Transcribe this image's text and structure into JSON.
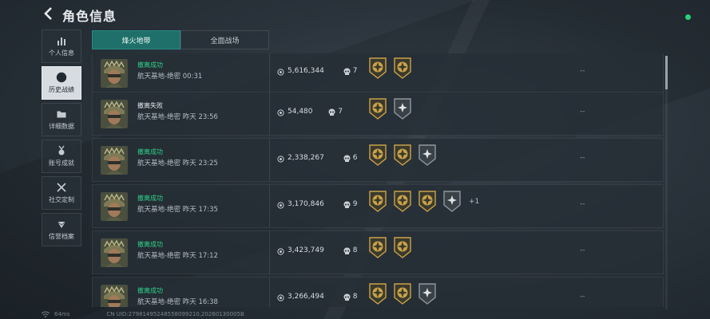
{
  "header": {
    "title": "角色信息"
  },
  "sidebar": {
    "items": [
      {
        "label": "个人信息",
        "icon": "bar-chart-icon"
      },
      {
        "label": "历史战绩",
        "icon": "clock-icon",
        "active": true
      },
      {
        "label": "详细数据",
        "icon": "folder-icon"
      },
      {
        "label": "账号成就",
        "icon": "medal-icon"
      },
      {
        "label": "社交定制",
        "icon": "tools-icon"
      },
      {
        "label": "信誉档案",
        "icon": "gem-icon"
      }
    ]
  },
  "tabs": [
    {
      "label": "烽火地带",
      "active": true
    },
    {
      "label": "全面战场",
      "active": false
    }
  ],
  "records": [
    {
      "status": "撤离成功",
      "success": true,
      "map": "航天基地-绝密 00:31",
      "money": "5,616,344",
      "kills": "7",
      "badges": [
        "gold",
        "gold"
      ],
      "extra": "",
      "right": "--"
    },
    {
      "status": "撤离失败",
      "success": false,
      "map": "航天基地-绝密 昨天 23:56",
      "money": "54,480",
      "kills": "7",
      "badges": [
        "gold",
        "grey"
      ],
      "extra": "",
      "right": "--"
    },
    {
      "status": "撤离成功",
      "success": true,
      "map": "航天基地-绝密 昨天 23:25",
      "money": "2,338,267",
      "kills": "6",
      "badges": [
        "gold",
        "gold",
        "grey"
      ],
      "extra": "",
      "right": "--"
    },
    {
      "status": "撤离成功",
      "success": true,
      "map": "航天基地-绝密 昨天 17:35",
      "money": "3,170,846",
      "kills": "9",
      "badges": [
        "gold",
        "gold",
        "gold",
        "grey"
      ],
      "extra": "+1",
      "right": "--"
    },
    {
      "status": "撤离成功",
      "success": true,
      "map": "航天基地-绝密 昨天 17:12",
      "money": "3,423,749",
      "kills": "8",
      "badges": [
        "gold",
        "gold"
      ],
      "extra": "",
      "right": "--"
    },
    {
      "status": "撤离成功",
      "success": true,
      "map": "航天基地-绝密 昨天 16:38",
      "money": "3,266,494",
      "kills": "8",
      "badges": [
        "gold",
        "gold",
        "grey"
      ],
      "extra": "",
      "right": "--"
    }
  ],
  "footer": {
    "ping": "64ms",
    "uid": "CN UID:27981495248558099210,20260130005B"
  },
  "colors": {
    "accent": "#1f6f6a",
    "success": "#2fd38a",
    "gold": "#c9a24a"
  }
}
